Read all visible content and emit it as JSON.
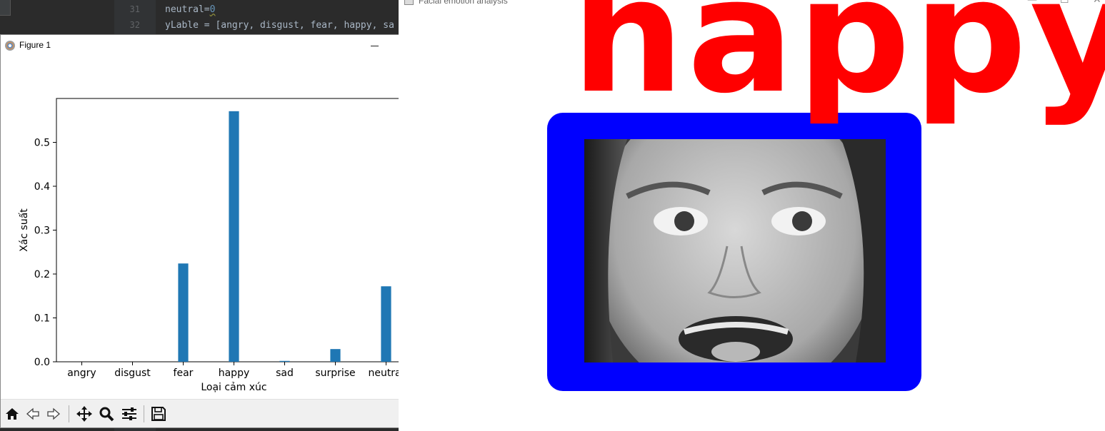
{
  "ide": {
    "lines": [
      {
        "number": "31",
        "prefix": "neutral=",
        "suffix": "0"
      },
      {
        "number": "32",
        "prefix": "yLable = [angry, disgust, fear, happy, sa",
        "suffix": ""
      }
    ]
  },
  "figure": {
    "title": "Figure 1",
    "toolbar": [
      {
        "icon": "home-icon",
        "label": "Home"
      },
      {
        "icon": "back-arrow-icon",
        "label": "Back"
      },
      {
        "icon": "forward-arrow-icon",
        "label": "Forward"
      },
      {
        "icon": "pan-icon",
        "label": "Pan"
      },
      {
        "icon": "zoom-icon",
        "label": "Zoom"
      },
      {
        "icon": "subplots-icon",
        "label": "Configure subplots"
      },
      {
        "icon": "save-icon",
        "label": "Save"
      }
    ]
  },
  "chart_data": {
    "type": "bar",
    "categories": [
      "angry",
      "disgust",
      "fear",
      "happy",
      "sad",
      "surprise",
      "neutral"
    ],
    "values": [
      0.0,
      0.0,
      0.224,
      0.571,
      0.002,
      0.029,
      0.172
    ],
    "title": "",
    "xlabel": "Loại cảm xúc",
    "ylabel": "Xác suất",
    "ylim": [
      0,
      0.6
    ],
    "yticks": [
      "0.0",
      "0.1",
      "0.2",
      "0.3",
      "0.4",
      "0.5"
    ],
    "bar_color": "#1f77b4",
    "grid": false
  },
  "facial": {
    "title": "Facial emotion analysis",
    "emotion_label": "happy",
    "label_color": "#ff0000",
    "box_color": "#0000ff"
  }
}
